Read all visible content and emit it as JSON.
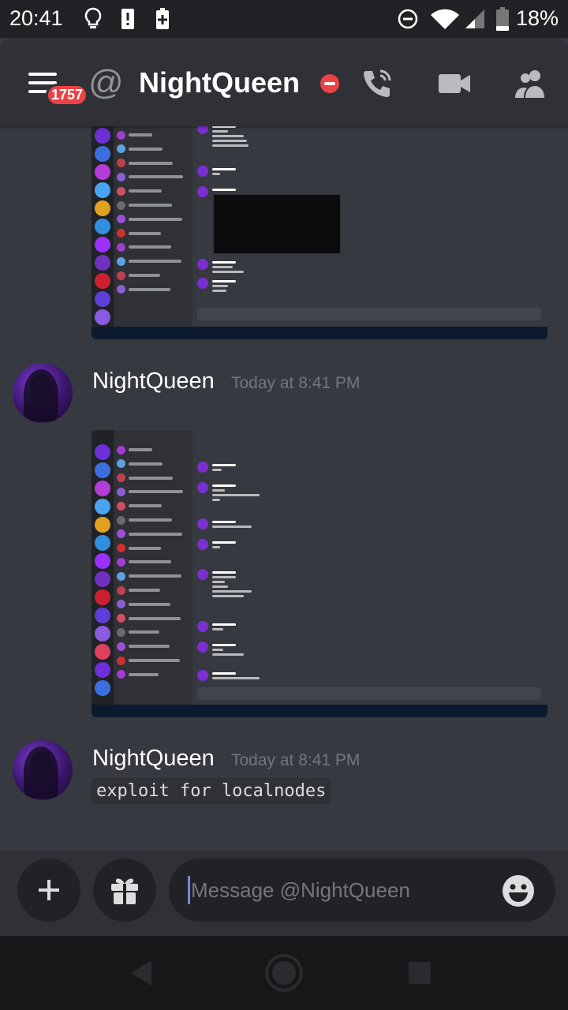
{
  "status_bar": {
    "time": "20:41",
    "battery": "18%"
  },
  "header": {
    "unread_badge": "1757",
    "channel_prefix": "@",
    "title": "NightQueen",
    "status": "dnd",
    "icons": [
      "call-icon",
      "video-icon",
      "members-icon"
    ]
  },
  "messages": [
    {
      "type": "attachment",
      "image": "screenshot of Discord desktop chat",
      "top_cropped": true
    },
    {
      "author": "NightQueen",
      "timestamp": "Today at 8:41 PM",
      "attachment": "screenshot of Discord desktop chat"
    },
    {
      "author": "NightQueen",
      "timestamp": "Today at 8:41 PM",
      "code": "exploit for localnodes"
    }
  ],
  "composer": {
    "placeholder": "Message @NightQueen",
    "buttons": [
      "plus-icon",
      "gift-icon",
      "emoji-icon"
    ]
  },
  "colors": {
    "background": "#36393f",
    "header": "#2f3136",
    "accent": "#7289da",
    "dnd": "#ed4245"
  }
}
